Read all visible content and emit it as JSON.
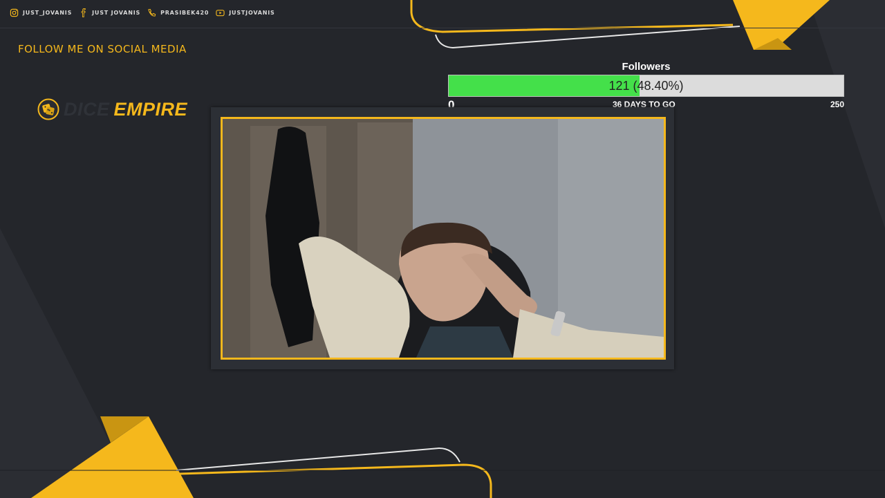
{
  "socials": [
    {
      "icon": "instagram-icon",
      "handle": "JUST_JOVANIS"
    },
    {
      "icon": "facebook-icon",
      "handle": "JUST JOVANIS"
    },
    {
      "icon": "phone-icon",
      "handle": "PRASIBEK420"
    },
    {
      "icon": "youtube-icon",
      "handle": "JUSTJOVANIS"
    }
  ],
  "follow_text": "FOLLOW ME ON SOCIAL MEDIA",
  "logo": {
    "dark_word": "DICE",
    "accent_word": "EMPIRE"
  },
  "goal": {
    "title": "Followers",
    "current": 121,
    "target": 250,
    "fraction": 0.484,
    "value_text": "121 (48.40%)",
    "min_label": "0",
    "max_label": "250",
    "days_label": "36 DAYS TO GO"
  },
  "colors": {
    "accent": "#f5b81c",
    "background": "#24262b",
    "progress": "#44e04a"
  }
}
